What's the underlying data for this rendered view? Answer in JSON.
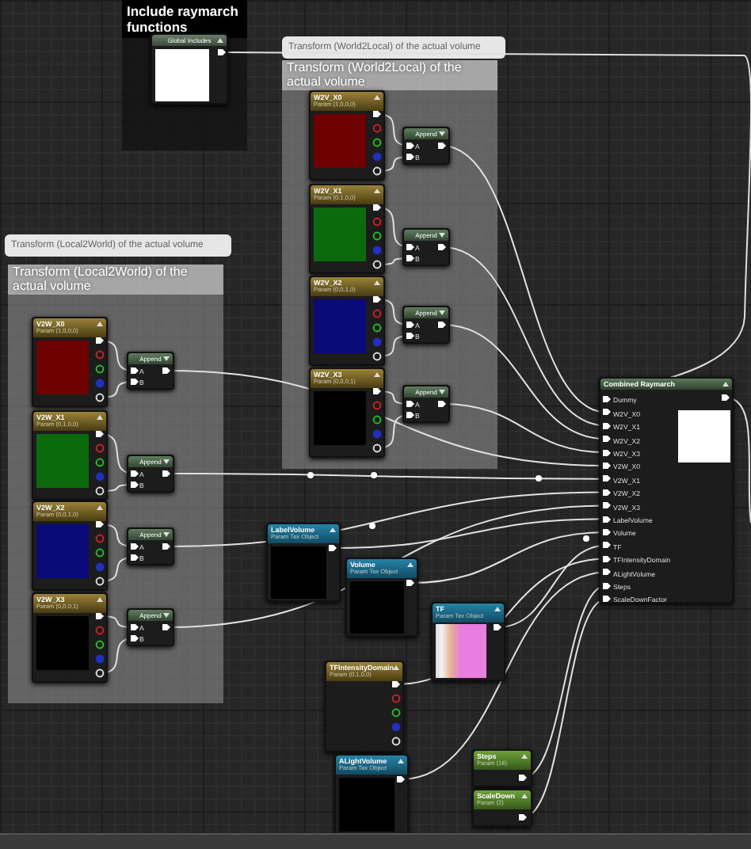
{
  "comments": [
    {
      "kind": "dark",
      "title": "Include raymarch functions"
    },
    {
      "kind": "light",
      "bubble": "Transform (World2Local) of the actual volume",
      "title": "Transform (World2Local) of the actual volume"
    },
    {
      "kind": "light",
      "bubble": "Transform (Local2World) of the actual volume",
      "title": "Transform (Local2World) of the actual volume"
    }
  ],
  "nodes": [
    {
      "kind": "custom",
      "title": "Global Includes"
    },
    {
      "kind": "vector",
      "title": "W2V_X0",
      "subtitle": "Param (1,0,0,0)",
      "color": "#6e0000"
    },
    {
      "kind": "vector",
      "title": "W2V_X1",
      "subtitle": "Param (0,1,0,0)",
      "color": "#0b6a0b"
    },
    {
      "kind": "vector",
      "title": "W2V_X2",
      "subtitle": "Param (0,0,1,0)",
      "color": "#0a0a78"
    },
    {
      "kind": "vector",
      "title": "W2V_X3",
      "subtitle": "Param (0,0,0,1)",
      "color": "#000000"
    },
    {
      "kind": "append",
      "title": "Append",
      "pins": [
        "A",
        "B"
      ]
    },
    {
      "kind": "append",
      "title": "Append",
      "pins": [
        "A",
        "B"
      ]
    },
    {
      "kind": "append",
      "title": "Append",
      "pins": [
        "A",
        "B"
      ]
    },
    {
      "kind": "append",
      "title": "Append",
      "pins": [
        "A",
        "B"
      ]
    },
    {
      "kind": "vector",
      "title": "V2W_X0",
      "subtitle": "Param (1,0,0,0)",
      "color": "#6e0000"
    },
    {
      "kind": "vector",
      "title": "V2W_X1",
      "subtitle": "Param (0,1,0,0)",
      "color": "#0b6a0b"
    },
    {
      "kind": "vector",
      "title": "V2W_X2",
      "subtitle": "Param (0,0,1,0)",
      "color": "#0a0a78"
    },
    {
      "kind": "vector",
      "title": "V2W_X3",
      "subtitle": "Param (0,0,0,1)",
      "color": "#000000"
    },
    {
      "kind": "append",
      "title": "Append",
      "pins": [
        "A",
        "B"
      ]
    },
    {
      "kind": "append",
      "title": "Append",
      "pins": [
        "A",
        "B"
      ]
    },
    {
      "kind": "append",
      "title": "Append",
      "pins": [
        "A",
        "B"
      ]
    },
    {
      "kind": "append",
      "title": "Append",
      "pins": [
        "A",
        "B"
      ]
    },
    {
      "kind": "texture",
      "title": "LabelVolume",
      "subtitle": "Param Tex Object"
    },
    {
      "kind": "texture",
      "title": "Volume",
      "subtitle": "Param Tex Object"
    },
    {
      "kind": "tf",
      "title": "TF",
      "subtitle": "Param Tex Object"
    },
    {
      "kind": "vector",
      "title": "TFIntensityDomain",
      "subtitle": "Param (0,1,0,0)"
    },
    {
      "kind": "texture",
      "title": "ALightVolume",
      "subtitle": "Param Tex Object"
    },
    {
      "kind": "scalar",
      "title": "Steps",
      "subtitle": "Param (16)"
    },
    {
      "kind": "scalar",
      "title": "ScaleDown",
      "subtitle": "Param (2)"
    },
    {
      "kind": "combined",
      "title": "Combined Raymarch",
      "inputs": [
        "Dummy",
        "W2V_X0",
        "W2V_X1",
        "W2V_X2",
        "W2V_X3",
        "V2W_X0",
        "V2W_X1",
        "V2W_X2",
        "V2W_X3",
        "LabelVolume",
        "Volume",
        "TF",
        "TFIntensityDomain",
        "ALightVolume",
        "Steps",
        "ScaleDownFactor"
      ]
    }
  ]
}
